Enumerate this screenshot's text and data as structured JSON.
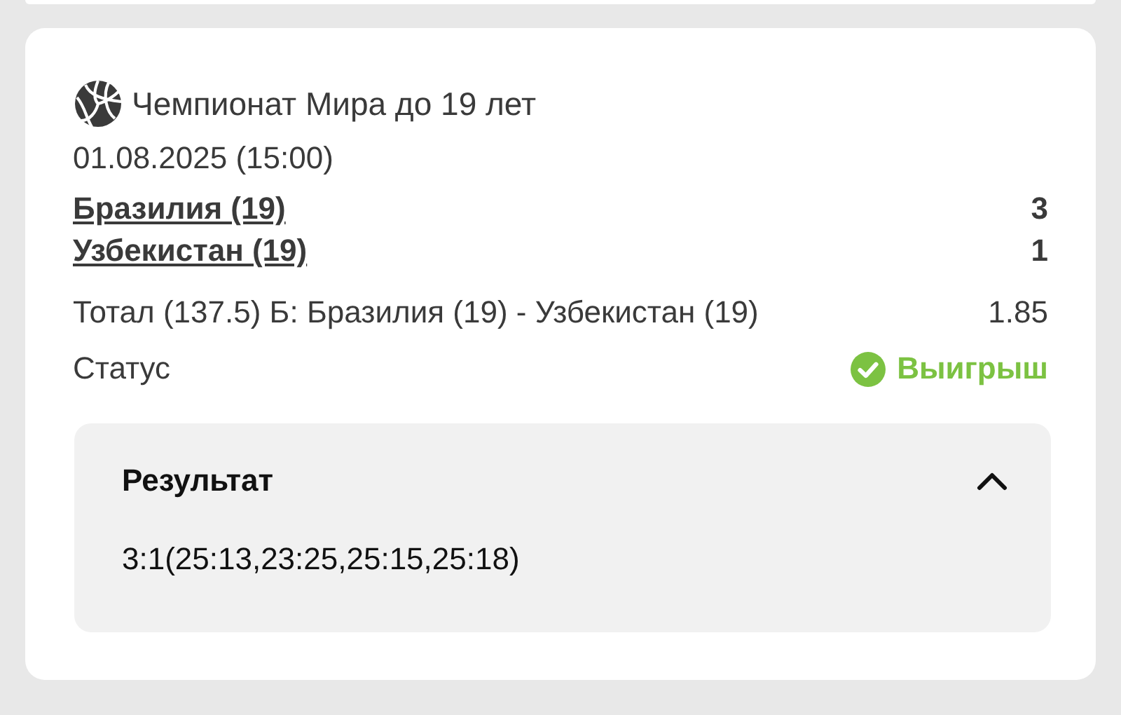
{
  "event": {
    "tournament": "Чемпионат Мира до 19 лет",
    "datetime": "01.08.2025 (15:00)",
    "teams": [
      {
        "name": "Бразилия (19)",
        "score": "3"
      },
      {
        "name": "Узбекистан (19)",
        "score": "1"
      }
    ],
    "bet": {
      "description": "Тотал (137.5) Б: Бразилия (19) - Узбекистан (19)",
      "odds": "1.85"
    },
    "status": {
      "label": "Статус",
      "value": "Выигрыш",
      "kind": "won"
    },
    "result": {
      "title": "Результат",
      "expanded": true,
      "text": "3:1(25:13,23:25,25:15,25:18)"
    }
  }
}
